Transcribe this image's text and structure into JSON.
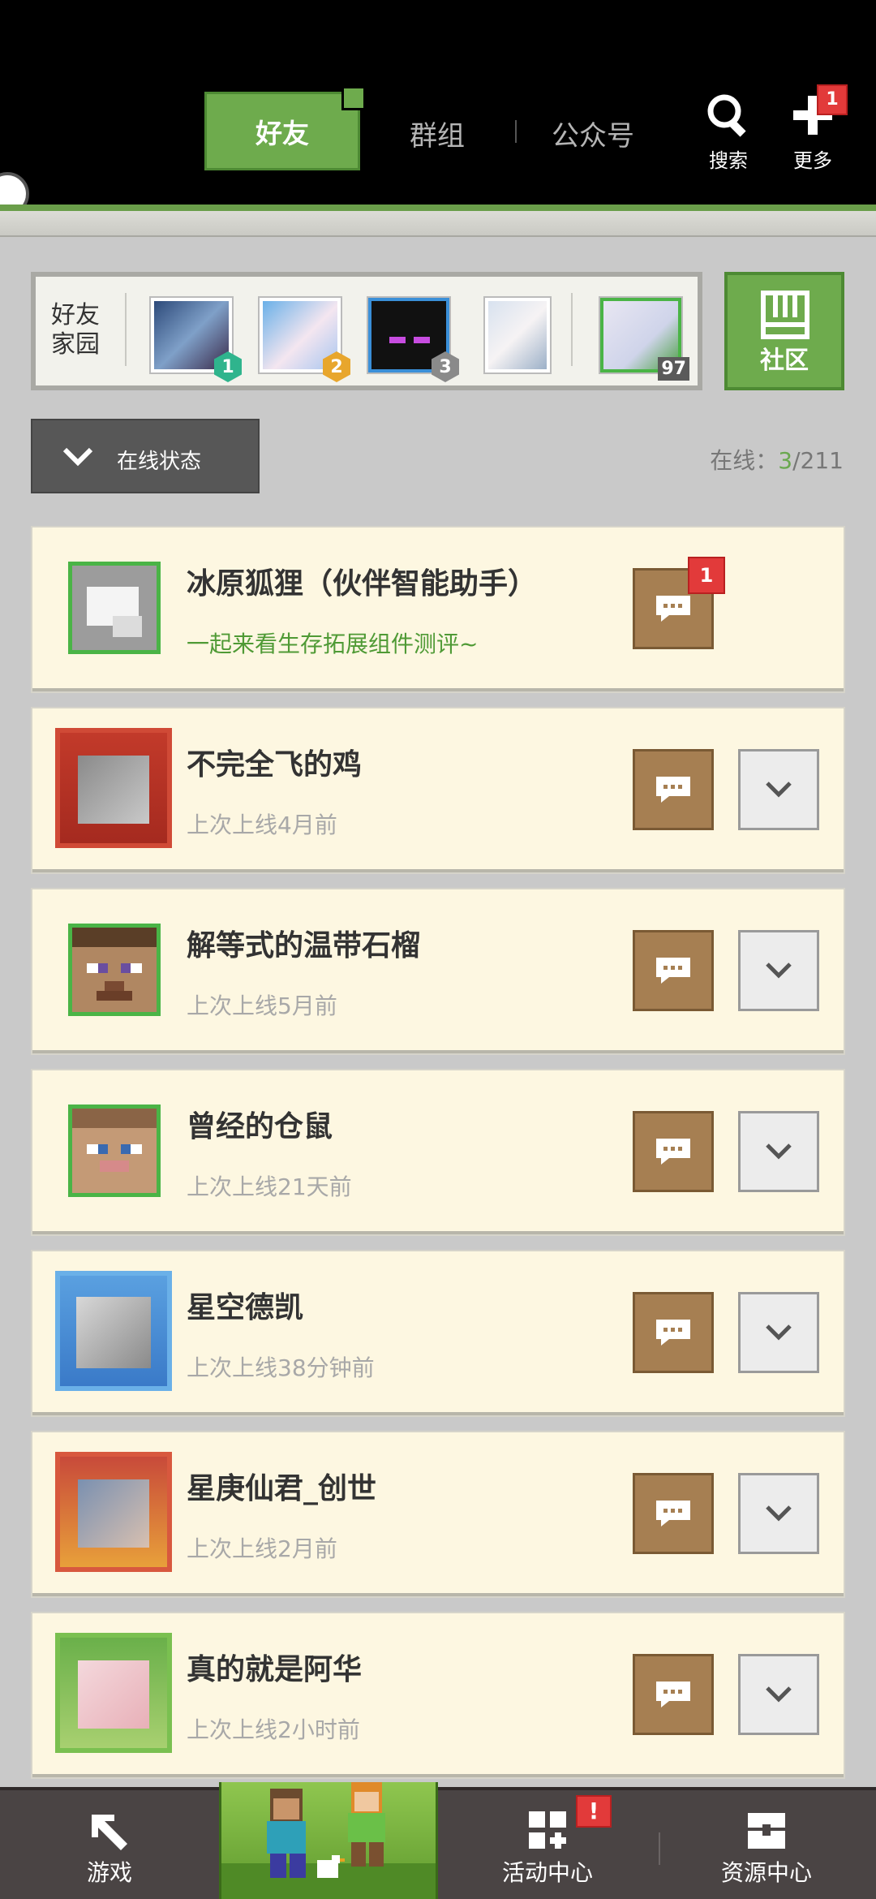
{
  "header": {
    "tabs": [
      {
        "label": "好友",
        "active": true
      },
      {
        "label": "群组",
        "active": false
      },
      {
        "label": "公众号",
        "active": false
      }
    ],
    "search_label": "搜索",
    "more_label": "更多",
    "more_badge": "1"
  },
  "friend_home": {
    "label": "好友家园",
    "ranks": [
      "1",
      "2",
      "3"
    ],
    "level": "97"
  },
  "community": {
    "label": "社区"
  },
  "online_status": {
    "button_label": "在线状态",
    "count_label": "在线：",
    "online": "3",
    "total": "/211"
  },
  "friends": [
    {
      "name": "冰原狐狸（伙伴智能助手）",
      "status": "一起来看生存拓展组件测评~",
      "chat_badge": "1",
      "has_more": false,
      "avatar": "fox-icon"
    },
    {
      "name": "不完全飞的鸡",
      "status": "上次上线4月前",
      "has_more": true,
      "avatar": "framed-photo"
    },
    {
      "name": "解等式的温带石榴",
      "status": "上次上线5月前",
      "has_more": true,
      "avatar": "steve-face"
    },
    {
      "name": "曾经的仓鼠",
      "status": "上次上线21天前",
      "has_more": true,
      "avatar": "steve-face"
    },
    {
      "name": "星空德凯",
      "status": "上次上线38分钟前",
      "has_more": true,
      "avatar": "framed-photo"
    },
    {
      "name": "星庚仙君_创世",
      "status": "上次上线2月前",
      "has_more": true,
      "avatar": "framed-photo"
    },
    {
      "name": "真的就是阿华",
      "status": "上次上线2小时前",
      "has_more": true,
      "avatar": "framed-photo"
    }
  ],
  "bottom_nav": {
    "items": [
      {
        "label": "游戏",
        "icon": "pickaxe-icon"
      },
      {
        "label": "",
        "icon": "characters-banner"
      },
      {
        "label": "活动中心",
        "icon": "grid-icon",
        "badge": "!"
      },
      {
        "label": "资源中心",
        "icon": "chest-icon"
      }
    ]
  },
  "colors": {
    "accent_green": "#6eab4d",
    "card_bg": "#fdf7e1",
    "chat_brown": "#a67f52",
    "badge_red": "#e23a3a"
  }
}
